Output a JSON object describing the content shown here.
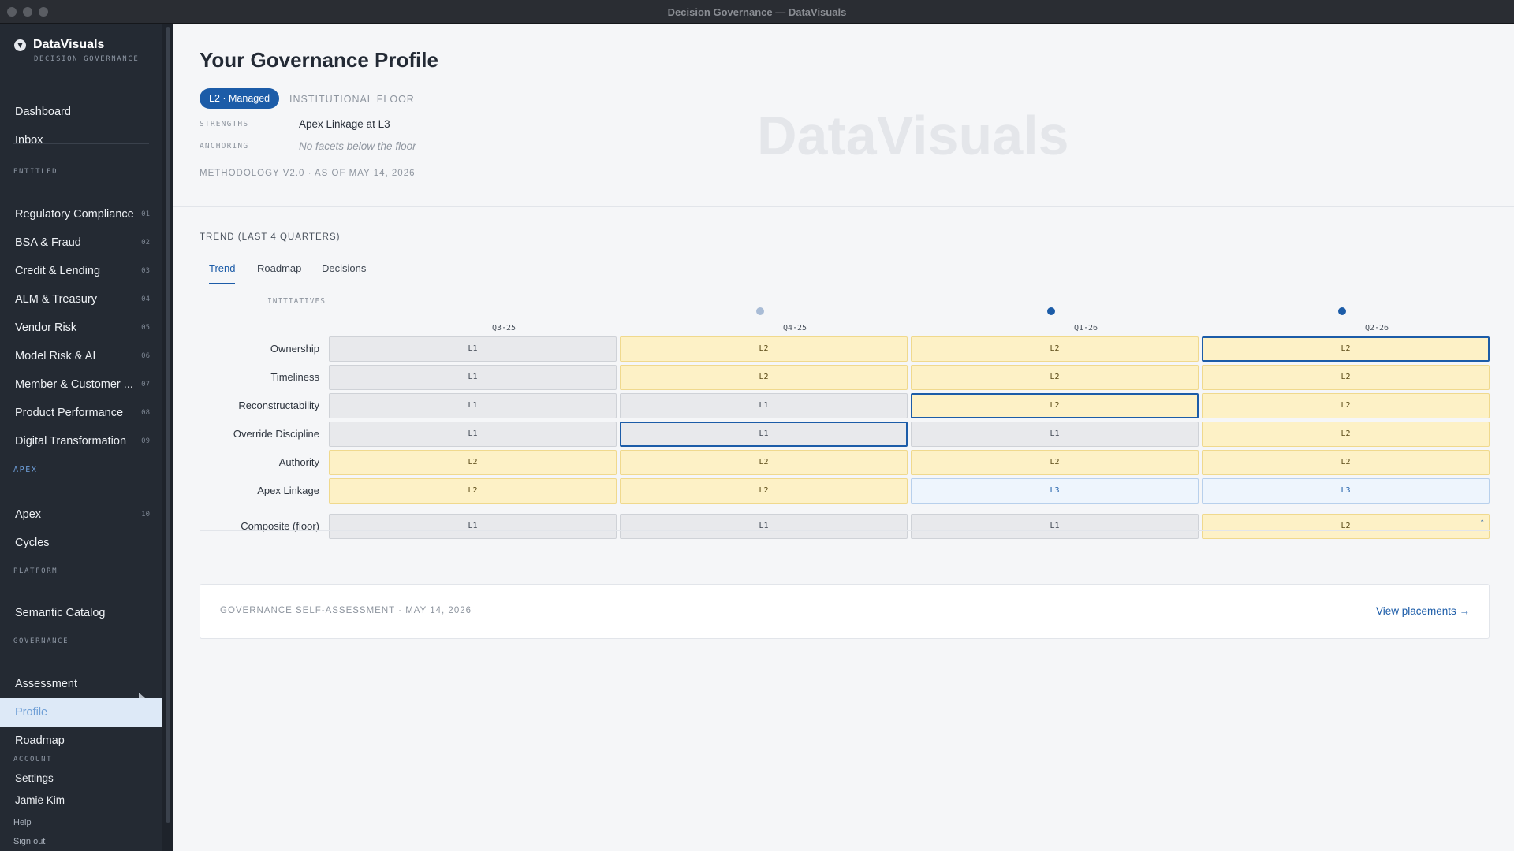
{
  "window": {
    "title": "Decision Governance — DataVisuals"
  },
  "brand": {
    "name": "DataVisuals",
    "subtitle": "DECISION GOVERNANCE"
  },
  "sidebar": {
    "top": [
      {
        "label": "Dashboard"
      },
      {
        "label": "Inbox"
      }
    ],
    "entitled_label": "ENTITLED",
    "entitled": [
      {
        "label": "Regulatory Compliance",
        "num": "01"
      },
      {
        "label": "BSA & Fraud",
        "num": "02"
      },
      {
        "label": "Credit & Lending",
        "num": "03"
      },
      {
        "label": "ALM & Treasury",
        "num": "04"
      },
      {
        "label": "Vendor Risk",
        "num": "05"
      },
      {
        "label": "Model Risk & AI",
        "num": "06"
      },
      {
        "label": "Member & Customer ...",
        "num": "07"
      },
      {
        "label": "Product Performance",
        "num": "08"
      },
      {
        "label": "Digital Transformation",
        "num": "09"
      }
    ],
    "apex_label": "APEX",
    "apex": [
      {
        "label": "Apex",
        "num": "10"
      },
      {
        "label": "Cycles"
      }
    ],
    "platform_label": "PLATFORM",
    "platform": [
      {
        "label": "Semantic Catalog"
      }
    ],
    "governance_label": "GOVERNANCE",
    "governance": [
      {
        "label": "Assessment"
      },
      {
        "label": "Profile"
      },
      {
        "label": "Roadmap"
      }
    ],
    "account_label": "ACCOUNT",
    "account": [
      {
        "label": "Settings"
      },
      {
        "label": "Jamie Kim"
      },
      {
        "label": "Help"
      },
      {
        "label": "Sign out"
      }
    ]
  },
  "profile": {
    "title": "Your Governance Profile",
    "level_badge": "L2 · Managed",
    "floor_label": "INSTITUTIONAL FLOOR",
    "strengths_label": "STRENGTHS",
    "strengths_value": "Apex Linkage at L3",
    "anchoring_label": "ANCHORING",
    "anchoring_value": "No facets below the floor",
    "methodology": "METHODOLOGY V2.0 · AS OF MAY 14, 2026",
    "watermark": "DataVisuals"
  },
  "trend": {
    "title": "TREND (LAST 4 QUARTERS)",
    "tabs": [
      "Trend",
      "Roadmap",
      "Decisions"
    ],
    "active_tab": "Trend",
    "initiatives_label": "INITIATIVES",
    "quarters": [
      "Q3·25",
      "Q4·25",
      "Q1·26",
      "Q2·26"
    ],
    "rows": [
      {
        "label": "Ownership",
        "levels": [
          "L1",
          "L2",
          "L2",
          "L2"
        ]
      },
      {
        "label": "Timeliness",
        "levels": [
          "L1",
          "L2",
          "L2",
          "L2"
        ]
      },
      {
        "label": "Reconstructability",
        "levels": [
          "L1",
          "L1",
          "L2",
          "L2"
        ]
      },
      {
        "label": "Override Discipline",
        "levels": [
          "L1",
          "L1",
          "L1",
          "L2"
        ]
      },
      {
        "label": "Authority",
        "levels": [
          "L2",
          "L2",
          "L2",
          "L2"
        ]
      },
      {
        "label": "Apex Linkage",
        "levels": [
          "L2",
          "L2",
          "L3",
          "L3"
        ]
      }
    ],
    "composite": {
      "label": "Composite (floor)",
      "levels": [
        "L1",
        "L1",
        "L1",
        "L2"
      ]
    }
  },
  "card": {
    "label": "GOVERNANCE SELF-ASSESSMENT · MAY 14, 2026",
    "link": "View placements →"
  }
}
